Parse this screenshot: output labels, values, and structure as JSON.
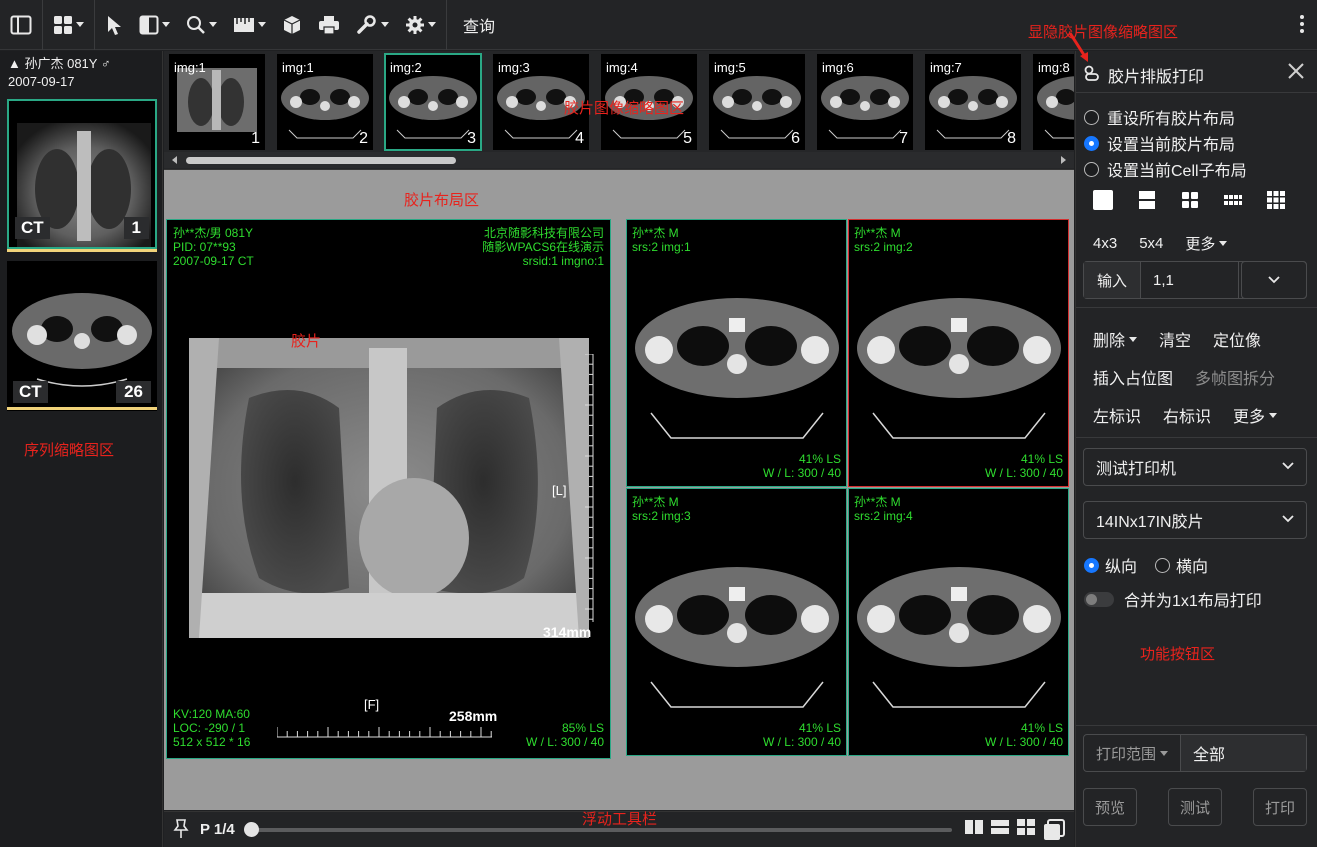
{
  "toolbar": {
    "query_label": "查询",
    "tools": [
      "sidebar-toggle-icon",
      "layout-grid-icon",
      "pointer-icon",
      "window-level-icon",
      "zoom-icon",
      "measure-ruler-icon",
      "3d-cube-icon",
      "printer-icon",
      "wrench-icon",
      "gear-icon"
    ]
  },
  "annotations": {
    "toggle_thumbnail": "显隐胶片图像缩略图区",
    "thumb_area": "胶片图像缩略图区",
    "layout_area": "胶片布局区",
    "film": "胶片",
    "series_area": "序列缩略图区",
    "func_area": "功能按钮区",
    "float_toolbar": "浮动工具栏"
  },
  "series_panel": {
    "patient": "▲ 孙广杰 081Y ♂",
    "date": "2007-09-17",
    "series": [
      {
        "modality": "CT",
        "count": "1"
      },
      {
        "modality": "CT",
        "count": "26"
      }
    ]
  },
  "thumbnails": [
    {
      "label": "img:1",
      "num": "1"
    },
    {
      "label": "img:1",
      "num": "2"
    },
    {
      "label": "img:2",
      "num": "3"
    },
    {
      "label": "img:3",
      "num": "4"
    },
    {
      "label": "img:4",
      "num": "5"
    },
    {
      "label": "img:5",
      "num": "6"
    },
    {
      "label": "img:6",
      "num": "7"
    },
    {
      "label": "img:7",
      "num": "8"
    },
    {
      "label": "img:8",
      "num": ""
    }
  ],
  "film_left": {
    "tl1": "孙**杰/男 081Y",
    "tl2": "PID: 07**93",
    "tl3": "2007-09-17 CT",
    "tr1": "北京随影科技有限公司",
    "tr2": "随影WPACS6在线演示",
    "tr3": "srsid:1 imgno:1",
    "bl1": "KV:120 MA:60",
    "bl2": "LOC: -290 / 1",
    "bl3": "512 x 512 * 16",
    "br1": "85% LS",
    "br2": "W / L:   300 / 40",
    "marker_l": "[L]",
    "marker_f": "[F]",
    "scale_v": "314mm",
    "scale_h": "258mm"
  },
  "cells": [
    {
      "name": "孙**杰 M",
      "srs": "srs:2 img:1",
      "ls": "41% LS",
      "wl": "W / L:   300 / 40"
    },
    {
      "name": "孙**杰 M",
      "srs": "srs:2 img:2",
      "ls": "41% LS",
      "wl": "W / L:   300 / 40"
    },
    {
      "name": "孙**杰 M",
      "srs": "srs:2 img:3",
      "ls": "41% LS",
      "wl": "W / L:   300 / 40"
    },
    {
      "name": "孙**杰 M",
      "srs": "srs:2 img:4",
      "ls": "41% LS",
      "wl": "W / L:   300 / 40"
    }
  ],
  "bottom_bar": {
    "page": "P 1/4",
    "page_progress": 0
  },
  "right_panel": {
    "title": "胶片排版打印",
    "radio_options": [
      "重设所有胶片布局",
      "设置当前胶片布局",
      "设置当前Cell子布局"
    ],
    "radio_selected": 1,
    "grid_options": [
      "4x3",
      "5x4",
      "更多"
    ],
    "input_label": "输入",
    "input_value": "1,1",
    "actions_row1": [
      "删除",
      "清空",
      "定位像"
    ],
    "actions_row2": [
      "插入占位图",
      "多帧图拆分"
    ],
    "actions_row3": [
      "左标识",
      "右标识",
      "更多"
    ],
    "printer": "测试打印机",
    "film_size": "14INx17IN胶片",
    "orientation_portrait": "纵向",
    "orientation_landscape": "横向",
    "merge_label": "合并为1x1布局打印",
    "range_label": "打印范围",
    "range_value": "全部",
    "btn_preview": "预览",
    "btn_test": "测试",
    "btn_print": "打印"
  }
}
